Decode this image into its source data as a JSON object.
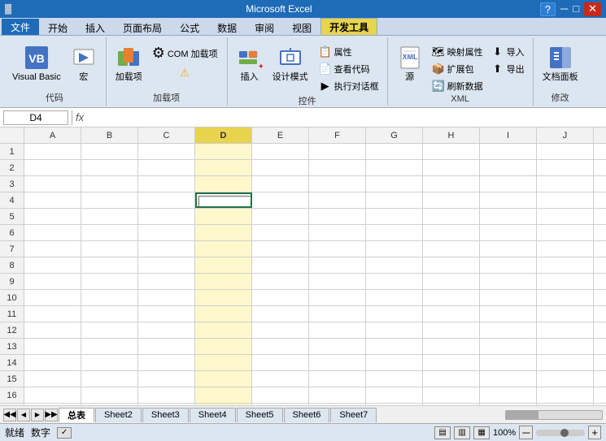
{
  "topbar": {
    "title": "Microsoft Excel",
    "minimize": "─",
    "restore": "□",
    "close": "✕",
    "help_icon": "?"
  },
  "ribbon": {
    "tabs": [
      {
        "id": "file",
        "label": "文件"
      },
      {
        "id": "home",
        "label": "开始"
      },
      {
        "id": "insert",
        "label": "插入"
      },
      {
        "id": "pagelayout",
        "label": "页面布局"
      },
      {
        "id": "formulas",
        "label": "公式"
      },
      {
        "id": "data",
        "label": "数据"
      },
      {
        "id": "review",
        "label": "审阅"
      },
      {
        "id": "view",
        "label": "视图"
      },
      {
        "id": "developer",
        "label": "开发工具",
        "active": true
      }
    ],
    "groups": {
      "code": {
        "label": "代码",
        "buttons": [
          {
            "id": "visual-basic",
            "label": "Visual Basic",
            "icon": "📋"
          },
          {
            "id": "macro",
            "label": "宏",
            "icon": "▶"
          }
        ]
      },
      "addins": {
        "label": "加载项",
        "buttons": [
          {
            "id": "addins",
            "label": "加载项",
            "icon": "🔧"
          },
          {
            "id": "com-addins",
            "label": "COM 加载项",
            "icon": "⚙"
          },
          {
            "id": "warning",
            "icon": "⚠"
          }
        ]
      },
      "controls": {
        "label": "控件",
        "buttons": [
          {
            "id": "insert-control",
            "label": "插入",
            "icon": "🔨"
          },
          {
            "id": "design-mode",
            "label": "设计模式",
            "icon": "📐"
          }
        ],
        "small_buttons": [
          {
            "id": "properties",
            "label": "属性"
          },
          {
            "id": "view-code",
            "label": "查看代码"
          },
          {
            "id": "run-dialog",
            "label": "执行对话框"
          }
        ]
      },
      "xml": {
        "label": "XML",
        "buttons": [
          {
            "id": "source",
            "label": "源",
            "icon": "📄"
          }
        ],
        "small_buttons": [
          {
            "id": "map-props",
            "label": "映射属性"
          },
          {
            "id": "expansion-packs",
            "label": "扩展包"
          },
          {
            "id": "refresh-data",
            "label": "刷新数据"
          },
          {
            "id": "import",
            "label": "导入"
          },
          {
            "id": "export",
            "label": "导出"
          }
        ]
      },
      "modify": {
        "label": "修改",
        "buttons": [
          {
            "id": "doc-panel",
            "label": "文档面板",
            "icon": "📋"
          }
        ]
      }
    }
  },
  "formula_bar": {
    "name_box": "D4",
    "fx_label": "fx",
    "value": ""
  },
  "grid": {
    "columns": [
      "A",
      "B",
      "C",
      "D",
      "E",
      "F",
      "G",
      "H",
      "I",
      "J"
    ],
    "rows": 18,
    "selected_col": "D",
    "active_cell": {
      "row": 4,
      "col": "D"
    },
    "widget_cell": {
      "row": 4,
      "col": "D"
    }
  },
  "sheet_tabs": [
    {
      "id": "sheet1",
      "label": "总表",
      "active": true
    },
    {
      "id": "sheet2",
      "label": "Sheet2"
    },
    {
      "id": "sheet3",
      "label": "Sheet3"
    },
    {
      "id": "sheet4",
      "label": "Sheet4"
    },
    {
      "id": "sheet5",
      "label": "Sheet5"
    },
    {
      "id": "sheet6",
      "label": "Sheet6"
    },
    {
      "id": "sheet7",
      "label": "Sheet7"
    }
  ],
  "status_bar": {
    "left": [
      "就绪",
      "数字"
    ],
    "zoom": "100%",
    "zoom_minus": "─",
    "zoom_plus": "+"
  }
}
